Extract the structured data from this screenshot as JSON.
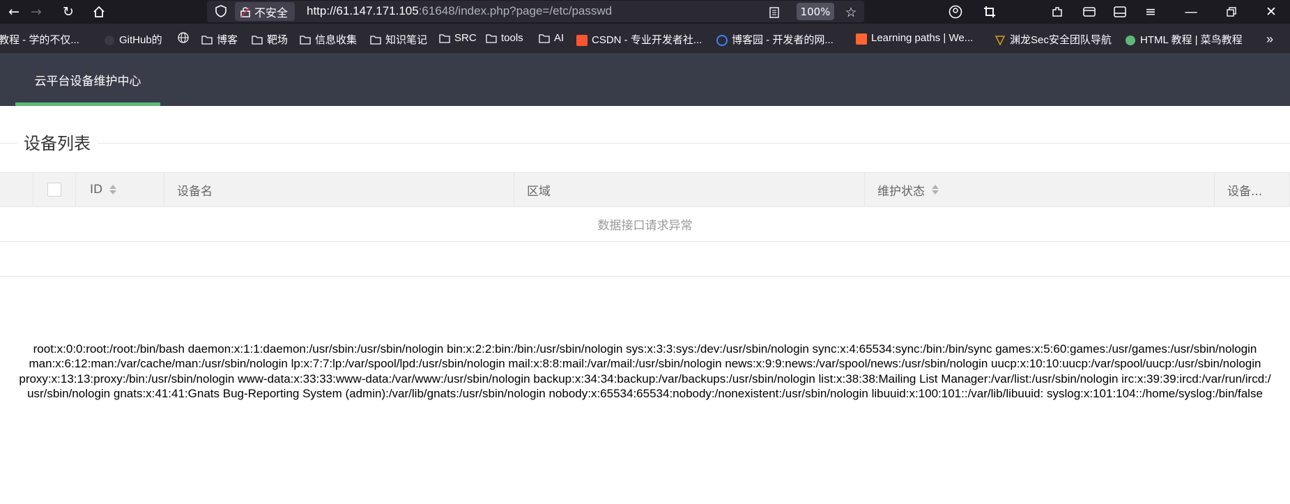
{
  "browser": {
    "insecure_label": "不安全",
    "url_host": "http://61.147.171.105",
    "url_rest": ":61648/index.php?page=/etc/passwd",
    "zoom": "100%",
    "bookmarks": [
      "教程 - 学的不仅...",
      "GitHub的",
      "",
      "博客",
      "靶场",
      "信息收集",
      "知识笔记",
      "SRC",
      "tools",
      "AI",
      "CSDN - 专业开发者社...",
      "博客园 - 开发者的网...",
      "Learning paths | We...",
      "渊龙Sec安全团队导航",
      "HTML 教程 | 菜鸟教程"
    ]
  },
  "app": {
    "nav_item": "云平台设备维护中心",
    "section_title": "设备列表",
    "table": {
      "headers": [
        "ID",
        "设备名",
        "区域",
        "维护状态",
        "设备..."
      ],
      "empty_message": "数据接口请求异常"
    },
    "passwd_lines": [
      "root:x:0:0:root:/root:/bin/bash daemon:x:1:1:daemon:/usr/sbin:/usr/sbin/nologin bin:x:2:2:bin:/bin:/usr/sbin/nologin sys:x:3:3:sys:/dev:/usr/sbin/nologin sync:x:4:65534:sync:/bin:/bin/sync games:x:5:60:games:/usr/games:/usr/sbin/nologin",
      "man:x:6:12:man:/var/cache/man:/usr/sbin/nologin lp:x:7:7:lp:/var/spool/lpd:/usr/sbin/nologin mail:x:8:8:mail:/var/mail:/usr/sbin/nologin news:x:9:9:news:/var/spool/news:/usr/sbin/nologin uucp:x:10:10:uucp:/var/spool/uucp:/usr/sbin/nologin",
      "proxy:x:13:13:proxy:/bin:/usr/sbin/nologin www-data:x:33:33:www-data:/var/www:/usr/sbin/nologin backup:x:34:34:backup:/var/backups:/usr/sbin/nologin list:x:38:38:Mailing List Manager:/var/list:/usr/sbin/nologin irc:x:39:39:ircd:/var/run/ircd:/",
      "usr/sbin/nologin gnats:x:41:41:Gnats Bug-Reporting System (admin):/var/lib/gnats:/usr/sbin/nologin nobody:x:65534:65534:nobody:/nonexistent:/usr/sbin/nologin libuuid:x:100:101::/var/lib/libuuid: syslog:x:101:104::/home/syslog:/bin/false"
    ]
  }
}
